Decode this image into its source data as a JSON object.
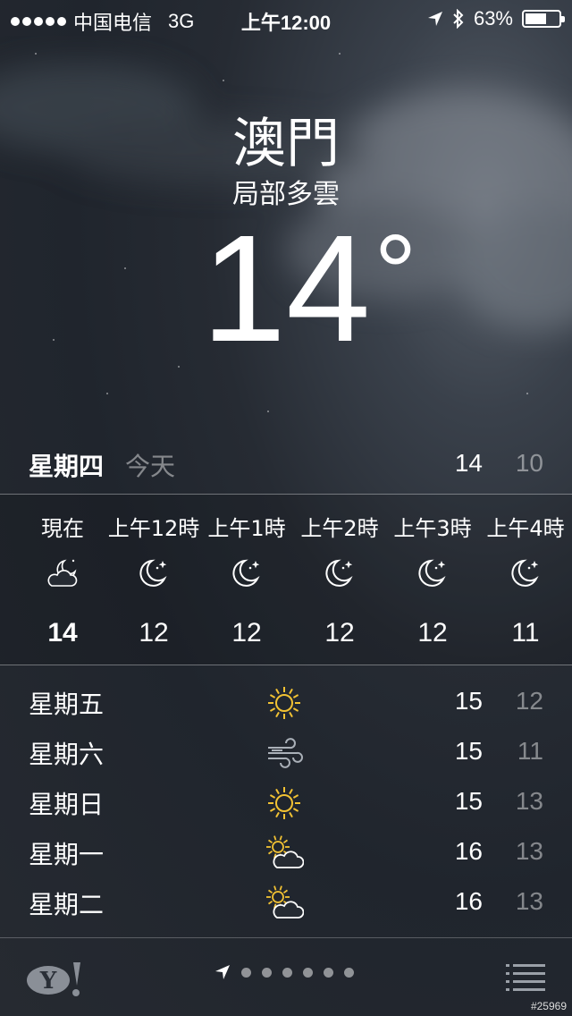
{
  "status_bar": {
    "carrier": "中国电信",
    "network": "3G",
    "time": "上午12:00",
    "battery": "63%",
    "battery_level": 0.63
  },
  "weather": {
    "city": "澳門",
    "condition": "局部多雲",
    "temperature": "14",
    "degree_symbol": "°"
  },
  "today": {
    "day": "星期四",
    "label": "今天",
    "high": "14",
    "low": "10"
  },
  "hourly": [
    {
      "time": "現在",
      "icon": "partly-cloudy-night-icon",
      "temp": "14"
    },
    {
      "time": "上午12時",
      "icon": "moon-stars-icon",
      "temp": "12"
    },
    {
      "time": "上午1時",
      "icon": "moon-stars-icon",
      "temp": "12"
    },
    {
      "time": "上午2時",
      "icon": "moon-stars-icon",
      "temp": "12"
    },
    {
      "time": "上午3時",
      "icon": "moon-stars-icon",
      "temp": "12"
    },
    {
      "time": "上午4時",
      "icon": "moon-stars-icon",
      "temp": "11"
    }
  ],
  "daily": [
    {
      "day": "星期五",
      "icon": "sun-icon",
      "high": "15",
      "low": "12"
    },
    {
      "day": "星期六",
      "icon": "wind-icon",
      "high": "15",
      "low": "11"
    },
    {
      "day": "星期日",
      "icon": "sun-icon",
      "high": "15",
      "low": "13"
    },
    {
      "day": "星期一",
      "icon": "partly-sunny-icon",
      "high": "16",
      "low": "13"
    },
    {
      "day": "星期二",
      "icon": "partly-sunny-icon",
      "high": "16",
      "low": "13"
    }
  ],
  "footer": {
    "page_count": 6,
    "watermark": "#25969"
  },
  "colors": {
    "sun": "#f2c233",
    "text": "#ffffff",
    "muted": "#8a8f97"
  }
}
